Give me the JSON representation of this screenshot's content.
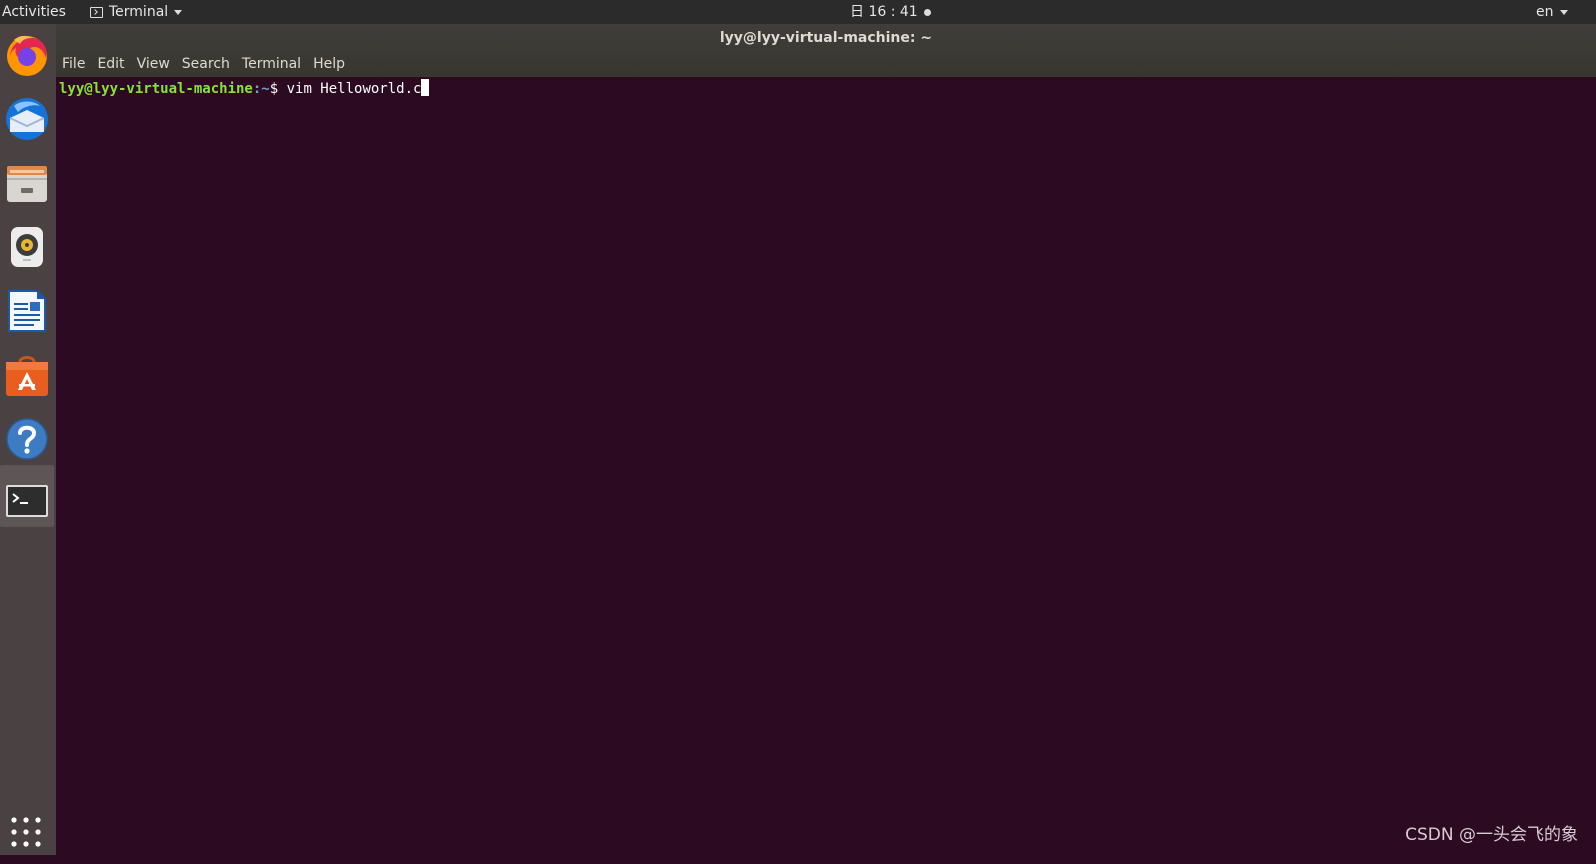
{
  "topbar": {
    "activities": "Activities",
    "app_menu_label": "Terminal",
    "clock": "日 16 : 41",
    "lang": "en"
  },
  "window": {
    "title": "lyy@lyy-virtual-machine: ~",
    "menu": [
      "File",
      "Edit",
      "View",
      "Search",
      "Terminal",
      "Help"
    ]
  },
  "terminal": {
    "user_host": "lyy@lyy-virtual-machine",
    "path": ":~",
    "prompt_symbol": "$ ",
    "command": "vim Helloworld.c"
  },
  "dock": {
    "apps": [
      "firefox-icon",
      "thunderbird-icon",
      "files-icon",
      "rhythmbox-icon",
      "writer-icon",
      "software-icon",
      "help-icon",
      "terminal-icon",
      "show-apps-icon"
    ]
  },
  "watermark": "CSDN @一头会飞的象",
  "colors": {
    "terminal_bg": "#2c0a22",
    "prompt_user": "#8ae234",
    "prompt_path": "#729fcf",
    "topbar_bg": "#2b2b2b",
    "dock_bg": "#4a4242"
  }
}
